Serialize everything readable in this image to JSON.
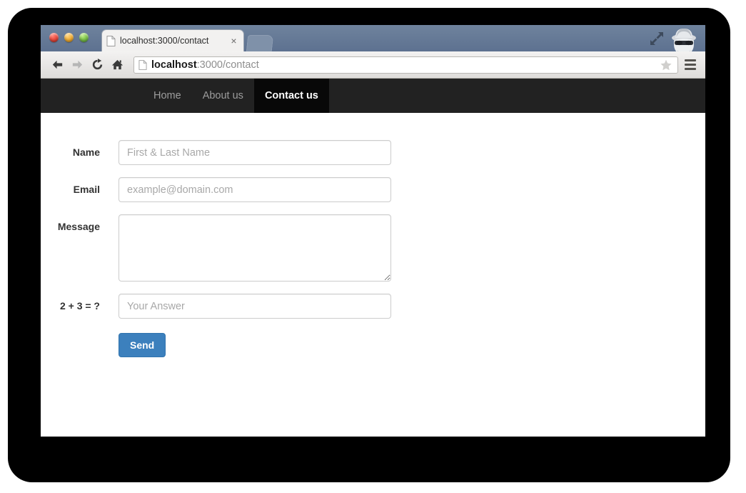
{
  "browser": {
    "tab": {
      "title": "localhost:3000/contact",
      "close_label": "×",
      "favicon_name": "page-icon"
    },
    "toolbar": {
      "back_label": "←",
      "forward_label": "→",
      "reload_label": "↻",
      "home_label": "⌂",
      "url_host": "localhost",
      "url_rest": ":3000/contact"
    },
    "window_controls": {
      "close": "close",
      "minimize": "minimize",
      "maximize": "maximize"
    },
    "incognito_label": "incognito"
  },
  "site": {
    "nav": [
      {
        "label": "Home",
        "active": false
      },
      {
        "label": "About us",
        "active": false
      },
      {
        "label": "Contact us",
        "active": true
      }
    ],
    "form": {
      "fields": [
        {
          "label": "Name",
          "placeholder": "First & Last Name",
          "value": "",
          "type": "text"
        },
        {
          "label": "Email",
          "placeholder": "example@domain.com",
          "value": "",
          "type": "text"
        },
        {
          "label": "Message",
          "placeholder": "",
          "value": "",
          "type": "textarea"
        },
        {
          "label": "2 + 3 = ?",
          "placeholder": "Your Answer",
          "value": "",
          "type": "text"
        }
      ],
      "submit_label": "Send"
    }
  },
  "colors": {
    "navbar_bg": "#222222",
    "navbar_active_bg": "#080808",
    "button_blue": "#3c80bd",
    "titlebar_blue": "#6f839d"
  }
}
